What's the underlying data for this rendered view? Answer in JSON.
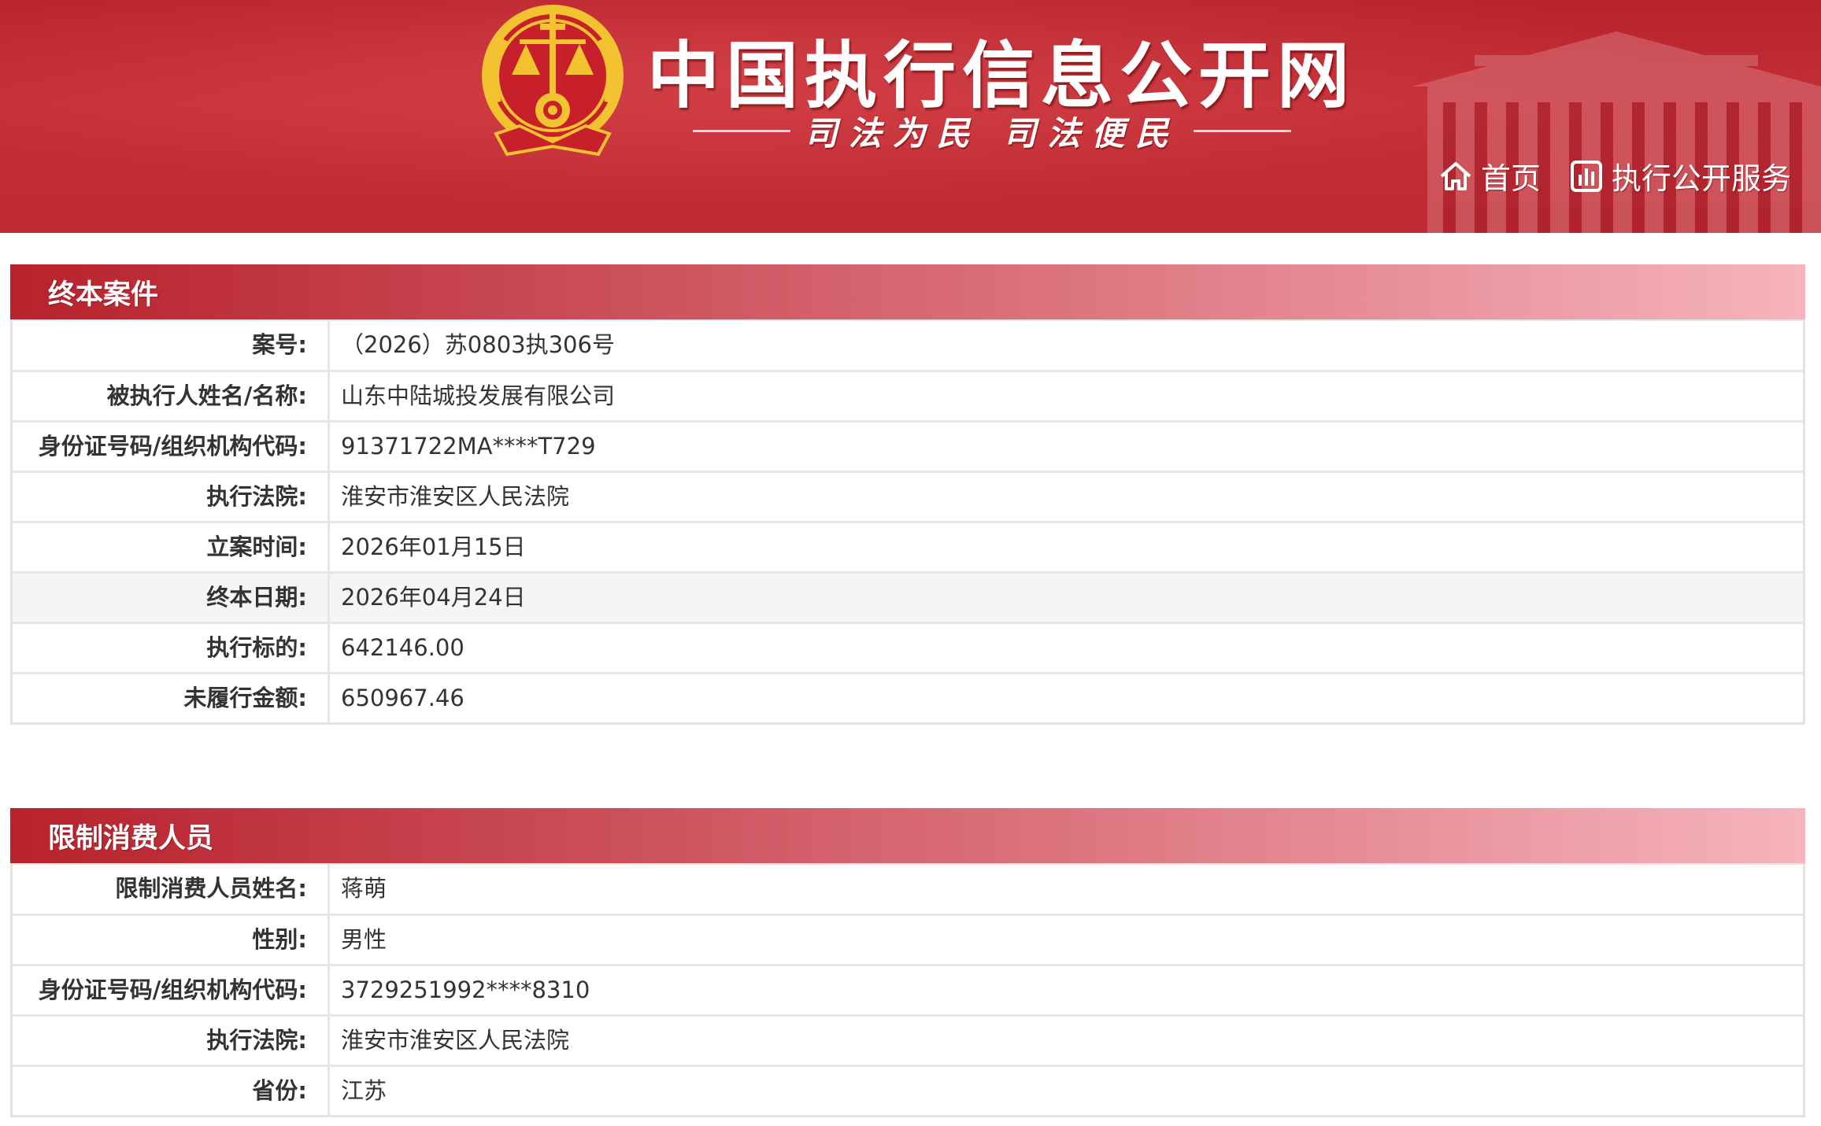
{
  "header": {
    "site_title": "中国执行信息公开网",
    "slogan": "司法为民  司法便民",
    "nav": [
      {
        "label": "首页",
        "icon": "home-icon"
      },
      {
        "label": "执行公开服务",
        "icon": "chart-bars-icon"
      }
    ],
    "colors": {
      "brand_red": "#b8222c",
      "gold": "#f2c230"
    }
  },
  "case_section": {
    "title": "终本案件",
    "rows": [
      {
        "label": "案号:",
        "value": "（2026）苏0803执306号"
      },
      {
        "label": "被执行人姓名/名称:",
        "value": "山东中陆城投发展有限公司"
      },
      {
        "label": "身份证号码/组织机构代码:",
        "value": "91371722MA****T729"
      },
      {
        "label": "执行法院:",
        "value": "淮安市淮安区人民法院"
      },
      {
        "label": "立案时间:",
        "value": "2026年01月15日"
      },
      {
        "label": "终本日期:",
        "value": "2026年04月24日"
      },
      {
        "label": "执行标的:",
        "value": "642146.00"
      },
      {
        "label": "未履行金额:",
        "value": "650967.46"
      }
    ]
  },
  "restrict_section": {
    "title": "限制消费人员",
    "rows": [
      {
        "label": "限制消费人员姓名:",
        "value": "蒋萌"
      },
      {
        "label": "性别:",
        "value": "男性"
      },
      {
        "label": "身份证号码/组织机构代码:",
        "value": "3729251992****8310"
      },
      {
        "label": "执行法院:",
        "value": "淮安市淮安区人民法院"
      },
      {
        "label": "省份:",
        "value": "江苏"
      }
    ]
  }
}
